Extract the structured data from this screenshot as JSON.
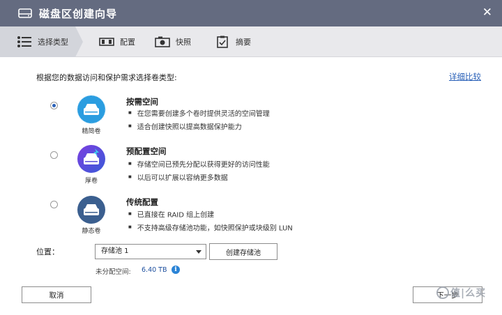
{
  "window": {
    "title": "磁盘区创建向导",
    "close_glyph": "✕",
    "icons": {
      "title": "disk-icon",
      "close": "close-icon"
    }
  },
  "steps": [
    {
      "label": "选择类型",
      "icon": "list-icon",
      "active": true
    },
    {
      "label": "配置",
      "icon": "volume-config-icon",
      "active": false
    },
    {
      "label": "快照",
      "icon": "camera-icon",
      "active": false
    },
    {
      "label": "摘要",
      "icon": "clipboard-icon",
      "active": false
    }
  ],
  "prompt": "根据您的数据访问和保护需求选择卷类型:",
  "compare_link": "详细比较",
  "options": [
    {
      "title": "按需空间",
      "caption": "精简卷",
      "checked": true,
      "icon_color": "#2b9de0",
      "bullets": [
        "在您需要创建多个卷时提供灵活的空间管理",
        "适合创建快照以提高数据保护能力"
      ]
    },
    {
      "title": "预配置空间",
      "caption": "厚卷",
      "checked": false,
      "icon_color": "#5a4bd8",
      "bullets": [
        "存储空间已预先分配以获得更好的访问性能",
        "以后可以扩展以容纳更多数据"
      ]
    },
    {
      "title": "传统配置",
      "caption": "静态卷",
      "checked": false,
      "icon_color": "#3b5f8f",
      "bullets": [
        "已直接在 RAID 组上创建",
        "不支持高级存储池功能，如快照保护或块级别 LUN"
      ]
    }
  ],
  "location": {
    "label": "位置：",
    "selected_pool": "存储池 1",
    "create_pool_label": "创建存储池",
    "unallocated_label": "未分配空间:",
    "unallocated_value": "6.40 TB",
    "info_glyph": "i"
  },
  "footer": {
    "cancel_label": "取消",
    "next_label": "下一步"
  },
  "watermark": {
    "text": "值|么买"
  }
}
